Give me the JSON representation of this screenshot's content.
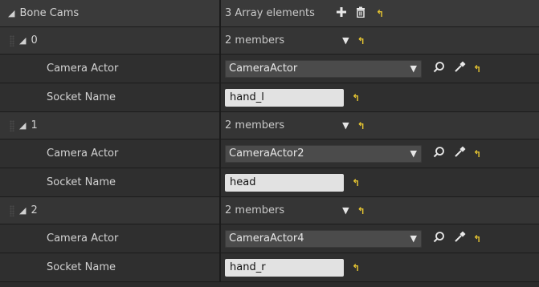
{
  "property": {
    "name": "Bone Cams",
    "summary": "3 Array elements"
  },
  "elements": [
    {
      "index": "0",
      "members": "2 members",
      "camera_label": "Camera Actor",
      "camera_value": "CameraActor",
      "socket_label": "Socket Name",
      "socket_value": "hand_l"
    },
    {
      "index": "1",
      "members": "2 members",
      "camera_label": "Camera Actor",
      "camera_value": "CameraActor2",
      "socket_label": "Socket Name",
      "socket_value": "head"
    },
    {
      "index": "2",
      "members": "2 members",
      "camera_label": "Camera Actor",
      "camera_value": "CameraActor4",
      "socket_label": "Socket Name",
      "socket_value": "hand_r"
    }
  ],
  "icons": {
    "expand": "expand-triangle-icon",
    "add": "plus-icon",
    "delete": "trash-icon",
    "reset": "reset-arrow-icon",
    "browse": "magnifier-icon",
    "pick": "eyedropper-icon",
    "dropdown": "chevron-down-icon"
  },
  "colors": {
    "accent": "#e6c531",
    "background": "#2f2f2f",
    "field": "#4b4b4b",
    "textbox": "#e2e2e2"
  }
}
